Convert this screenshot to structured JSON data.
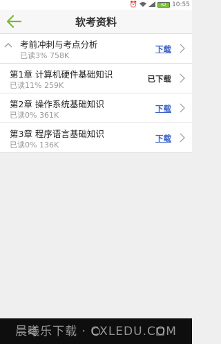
{
  "status": {
    "time": "10:55",
    "battery": "62"
  },
  "header": {
    "title": "软考资料"
  },
  "items": [
    {
      "name": "考前冲刺与考点分析",
      "meta": "已读3%  758K",
      "action": "下载",
      "state": "download"
    },
    {
      "name": "第1章 计算机硬件基础知识",
      "meta": "已读11%  259K",
      "action": "已下载",
      "state": "done"
    },
    {
      "name": "第2章 操作系统基础知识",
      "meta": "已读0%  361K",
      "action": "下载",
      "state": "download"
    },
    {
      "name": "第3章 程序语言基础知识",
      "meta": "已读0%  136K",
      "action": "下载",
      "state": "download"
    }
  ],
  "watermark": "晨曦乐下载 · CXLEDU.COM",
  "colors": {
    "accent": "#7ab836",
    "link": "#3b62c4"
  }
}
